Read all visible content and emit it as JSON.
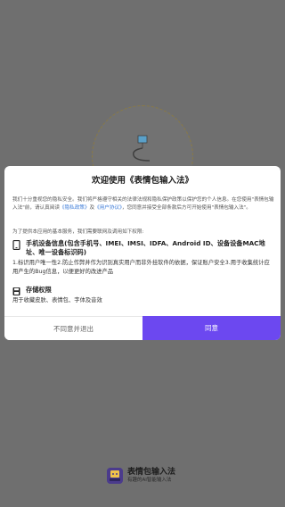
{
  "dialog": {
    "title": "欢迎使用《表情包输入法》",
    "intro_before": "我们十分重视您的隐私安全。我们将严格遵守相关的法律法规和隐私保护政策以保护您的个人信息。在您使用\"表情包输入法\"前，请认真阅读",
    "privacy_link": "《隐私政策》",
    "and_text": "及",
    "agreement_link": "《用户协议》",
    "intro_after": "，您同意并接受全部条款后方可开始使用\"表情包输入法\"。",
    "provide_note": "为了提供本应用的基本服务，我们需要联网及调用如下权限:",
    "permissions": [
      {
        "icon": "phone-icon",
        "title": "手机设备信息(包含手机号、IMEI、IMSI、IDFA、Android ID、设备设备MAC地址、唯一设备标识码)",
        "desc": "1.标识用户唯一性2.防止作弊并作为识别真实用户而非外挂软件的依据，保证账户安全3.用于收集统计应用产生的Bug信息，以便更好的改进产品"
      },
      {
        "icon": "storage-icon",
        "title": "存储权限",
        "desc": "用于收藏皮肤、表情包、字体及音效"
      }
    ],
    "decline_label": "不同意并退出",
    "accept_label": "同意"
  },
  "brand": {
    "name": "表情包输入法",
    "slogan": "有趣的AI智能输入法"
  },
  "colors": {
    "accent": "#6c48f0",
    "link": "#3b7bd8",
    "overlay": "#6f6f6f"
  }
}
